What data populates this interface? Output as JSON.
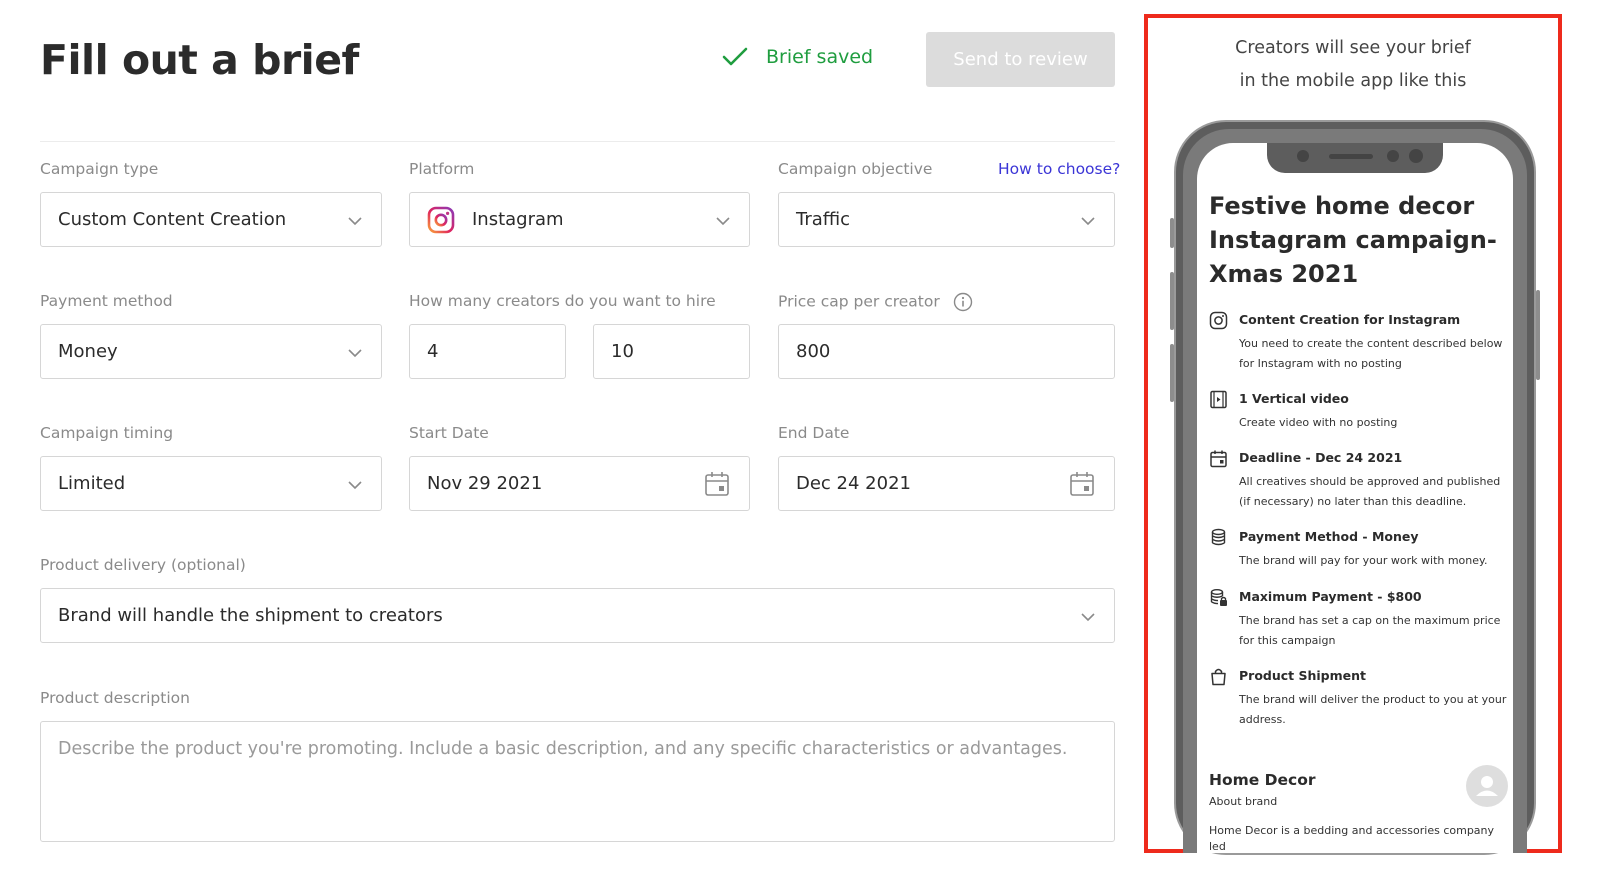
{
  "header": {
    "title": "Fill out a brief",
    "saved_status": "Brief saved",
    "send_button": "Send to review"
  },
  "form": {
    "campaign_type": {
      "label": "Campaign type",
      "value": "Custom Content Creation"
    },
    "platform": {
      "label": "Platform",
      "value": "Instagram"
    },
    "objective": {
      "label": "Campaign objective",
      "value": "Traffic",
      "help_link": "How to choose?"
    },
    "payment_method": {
      "label": "Payment method",
      "value": "Money"
    },
    "creators": {
      "label": "How many creators do you want to hire",
      "min": "4",
      "max": "10"
    },
    "price_cap": {
      "label": "Price cap per creator",
      "value": "800"
    },
    "timing": {
      "label": "Campaign timing",
      "value": "Limited"
    },
    "start_date": {
      "label": "Start Date",
      "value": "Nov 29 2021"
    },
    "end_date": {
      "label": "End Date",
      "value": "Dec 24 2021"
    },
    "delivery": {
      "label": "Product delivery (optional)",
      "value": "Brand will handle the shipment to creators"
    },
    "description": {
      "label": "Product description",
      "placeholder": "Describe the product you're promoting. Include a basic description, and any specific characteristics or advantages."
    }
  },
  "preview": {
    "caption_line1": "Creators will see your brief",
    "caption_line2": "in the mobile app like this",
    "title": "Festive home decor Instagram campaign-Xmas 2021",
    "items": [
      {
        "icon": "instagram-icon",
        "title": "Content Creation for Instagram",
        "desc": "You need to create the content described below for Instagram with no posting"
      },
      {
        "icon": "video-icon",
        "title": "1 Vertical video",
        "desc": "Create video with no posting"
      },
      {
        "icon": "calendar-icon",
        "title": "Deadline - Dec 24 2021",
        "desc": "All creatives should be approved and published (if necessary) no later than this deadline."
      },
      {
        "icon": "coins-icon",
        "title": "Payment Method - Money",
        "desc": "The brand will pay for your work with money."
      },
      {
        "icon": "coins-lock-icon",
        "title": "Maximum Payment - $800",
        "desc": "The brand has set a cap on the maximum price for this campaign"
      },
      {
        "icon": "shopping-bag-icon",
        "title": "Product Shipment",
        "desc": "The brand will deliver the product to you at your address."
      }
    ],
    "brand_name": "Home Decor",
    "brand_sub": "About brand",
    "brand_text": "Home Decor is a bedding and accessories company led"
  },
  "colors": {
    "success": "#1f9d3f",
    "link": "#3b35d6",
    "highlight_border": "#ee2a1c",
    "disabled_button": "#dcdcdc"
  }
}
